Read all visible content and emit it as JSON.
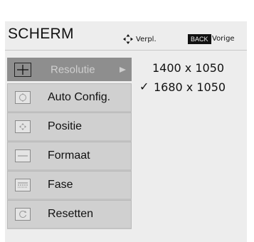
{
  "header": {
    "title": "SCHERM",
    "move_label": "Verpl.",
    "back_key": "BACK",
    "back_label": "Vorige"
  },
  "menu": {
    "items": [
      {
        "label": "Resolutie",
        "icon": "resolution-icon",
        "selected": true
      },
      {
        "label": "Auto Config.",
        "icon": "auto-config-icon",
        "selected": false
      },
      {
        "label": "Positie",
        "icon": "position-icon",
        "selected": false
      },
      {
        "label": "Formaat",
        "icon": "size-icon",
        "selected": false
      },
      {
        "label": "Fase",
        "icon": "phase-icon",
        "selected": false
      },
      {
        "label": "Resetten",
        "icon": "reset-icon",
        "selected": false
      }
    ]
  },
  "options": [
    {
      "value": "1400 x 1050",
      "checked": false
    },
    {
      "value": "1680 x 1050",
      "checked": true,
      "check_mark": "✓"
    }
  ],
  "colors": {
    "background": "#ededed",
    "selected_item": "#8e8e8e",
    "menu_item": "#d0d0d0",
    "selected_text": "#cfcfcf"
  }
}
